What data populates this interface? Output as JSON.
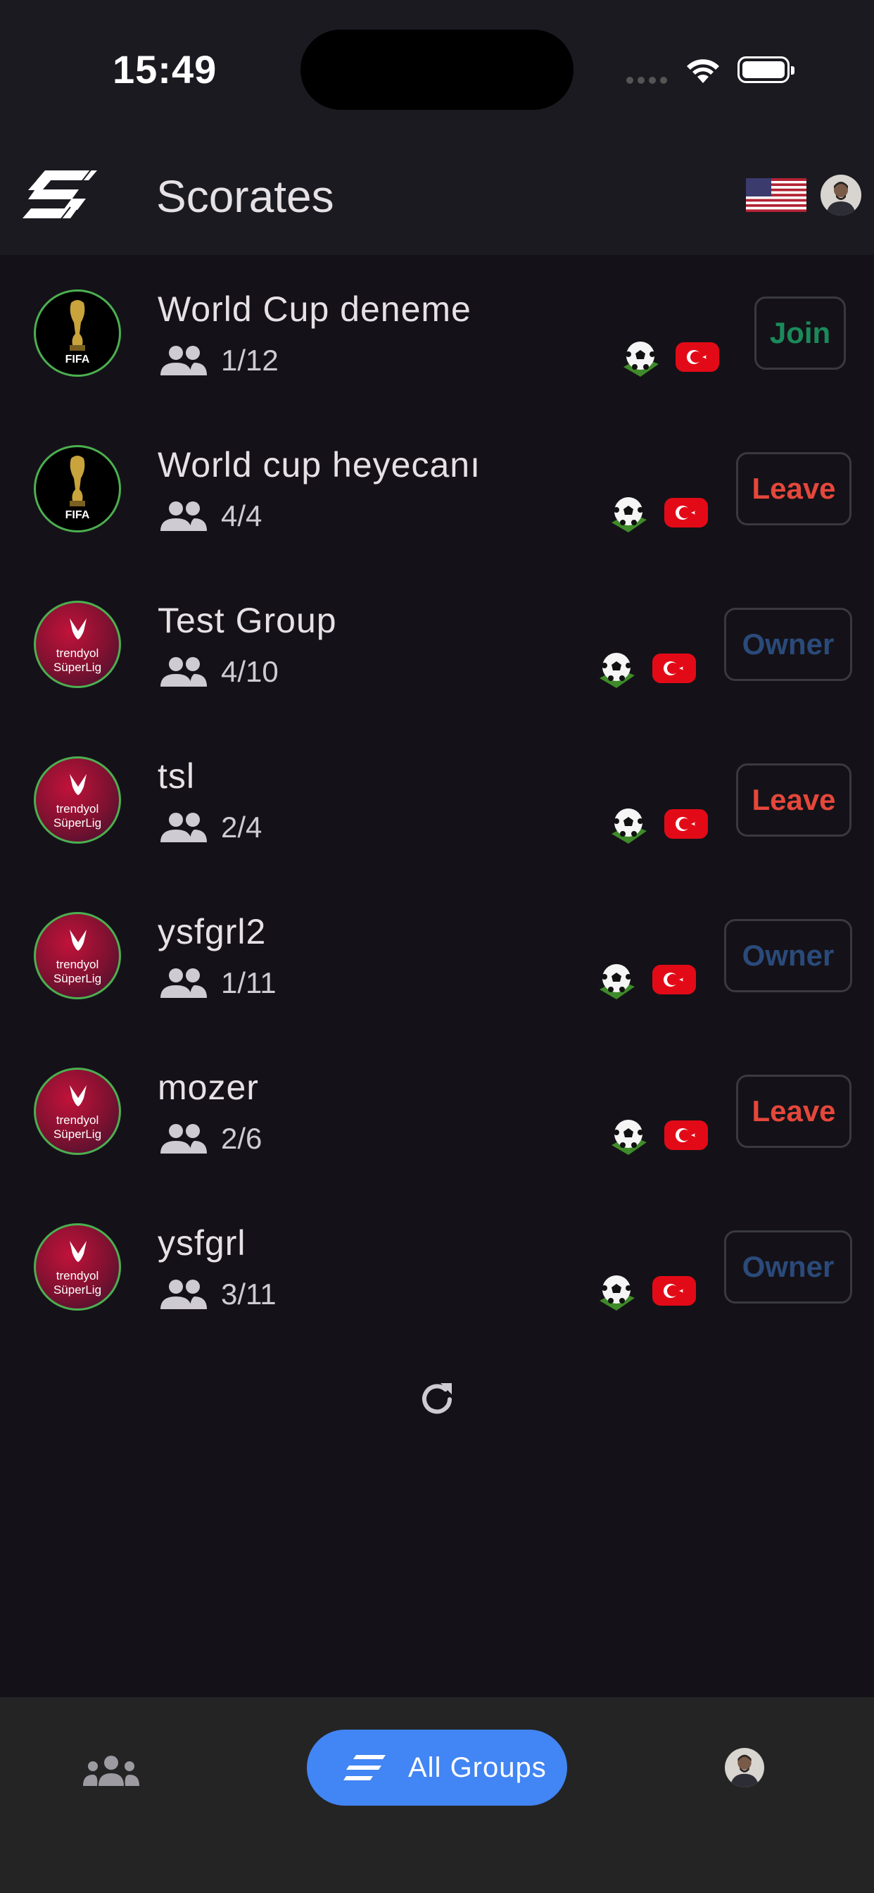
{
  "status_bar": {
    "time": "15:49"
  },
  "app": {
    "title": "Scorates"
  },
  "groups": [
    {
      "name": "World Cup deneme",
      "members": "1/12",
      "league": "fifa",
      "league_label": "FIFA",
      "action": "Join",
      "action_type": "join"
    },
    {
      "name": "World cup heyecanı",
      "members": "4/4",
      "league": "fifa",
      "league_label": "FIFA",
      "action": "Leave",
      "action_type": "leave"
    },
    {
      "name": "Test Group",
      "members": "4/10",
      "league": "tsl",
      "league_label": "trendyol SüperLig",
      "action": "Owner",
      "action_type": "owner"
    },
    {
      "name": "tsl",
      "members": "2/4",
      "league": "tsl",
      "league_label": "trendyol SüperLig",
      "action": "Leave",
      "action_type": "leave"
    },
    {
      "name": "ysfgrl2",
      "members": "1/11",
      "league": "tsl",
      "league_label": "trendyol SüperLig",
      "action": "Owner",
      "action_type": "owner"
    },
    {
      "name": "mozer",
      "members": "2/6",
      "league": "tsl",
      "league_label": "trendyol SüperLig",
      "action": "Leave",
      "action_type": "leave"
    },
    {
      "name": "ysfgrl",
      "members": "3/11",
      "league": "tsl",
      "league_label": "trendyol SüperLig",
      "action": "Owner",
      "action_type": "owner"
    }
  ],
  "bottom_nav": {
    "active_label": "All Groups"
  },
  "colors": {
    "join": "#1b8a5a",
    "leave": "#e5473b",
    "owner": "#2a4a7a",
    "accent": "#4285f4"
  },
  "icons": {
    "members": "people-icon",
    "sport": "soccer-ball-icon",
    "country": "turkey-flag-icon",
    "language": "us-flag-icon",
    "refresh": "refresh-icon"
  }
}
